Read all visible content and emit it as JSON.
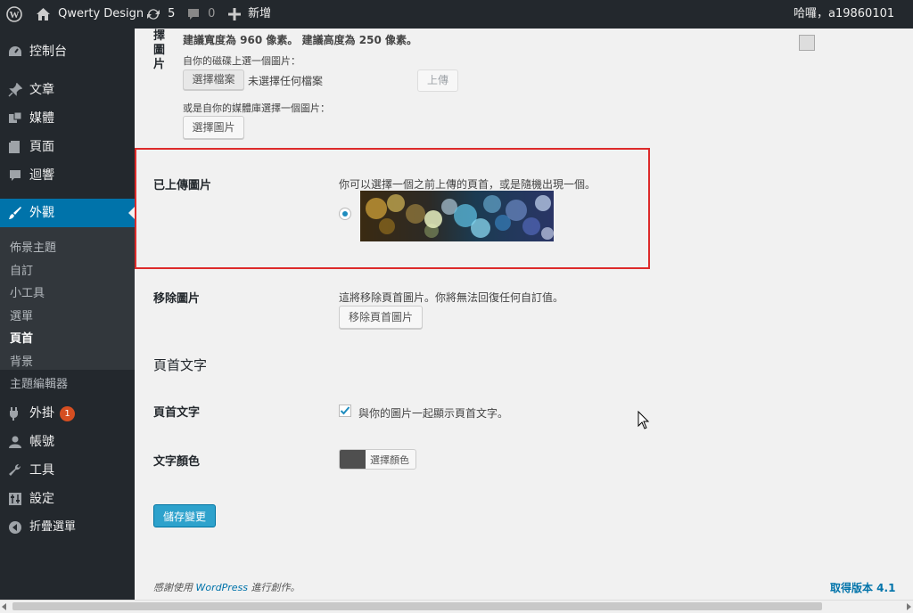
{
  "adminbar": {
    "site_name": "Qwerty Design",
    "updates_count": "5",
    "comments_count": "0",
    "new_label": "新增",
    "greeting": "哈囉，a19860101"
  },
  "sidebar": {
    "items": [
      {
        "label": "控制台",
        "icon": "dashboard-icon"
      },
      {
        "label": "文章",
        "icon": "pin-icon"
      },
      {
        "label": "媒體",
        "icon": "media-icon"
      },
      {
        "label": "頁面",
        "icon": "page-icon"
      },
      {
        "label": "迴響",
        "icon": "comment-icon"
      },
      {
        "label": "外觀",
        "icon": "brush-icon"
      },
      {
        "label": "外掛",
        "icon": "plugin-icon",
        "badge": "1"
      },
      {
        "label": "帳號",
        "icon": "user-icon"
      },
      {
        "label": "工具",
        "icon": "wrench-icon"
      },
      {
        "label": "設定",
        "icon": "settings-icon"
      },
      {
        "label": "折疊選單",
        "icon": "collapse-icon"
      }
    ],
    "submenu": [
      "佈景主題",
      "自訂",
      "小工具",
      "選單",
      "頁首",
      "背景",
      "主題編輯器"
    ]
  },
  "upload": {
    "select_image_label_chars": [
      "擇",
      "圖",
      "片"
    ],
    "recommend": "建議寬度為 960 像素。 建議高度為 250 像素。",
    "from_disk": "自你的磁碟上選一個圖片：",
    "choose_file": "選擇檔案",
    "no_file": "未選擇任何檔案",
    "upload_btn": "上傳",
    "from_library": "或是自你的媒體庫選擇一個圖片：",
    "choose_image_btn": "選擇圖片"
  },
  "uploaded": {
    "label": "已上傳圖片",
    "desc": "你可以選擇一個之前上傳的頁首，或是隨機出現一個。"
  },
  "remove": {
    "label": "移除圖片",
    "desc": "這將移除頁首圖片。你將無法回復任何自訂值。",
    "btn": "移除頁首圖片"
  },
  "header_text": {
    "section_title": "頁首文字",
    "label": "頁首文字",
    "checkbox_label": "與你的圖片一起顯示頁首文字。",
    "checked": true
  },
  "text_color": {
    "label": "文字顏色",
    "btn": "選擇顏色",
    "swatch": "#4f4f4f"
  },
  "save_btn": "儲存變更",
  "footer": {
    "thanks_prefix": "感謝使用",
    "wp_link": "WordPress",
    "thanks_suffix": "進行創作。",
    "version": "取得版本 4.1"
  },
  "colors": {
    "accent": "#0073aa",
    "sidebar_bg": "#23282d",
    "highlight_border": "#dd2b2b",
    "primary_button": "#2ea2cc"
  }
}
